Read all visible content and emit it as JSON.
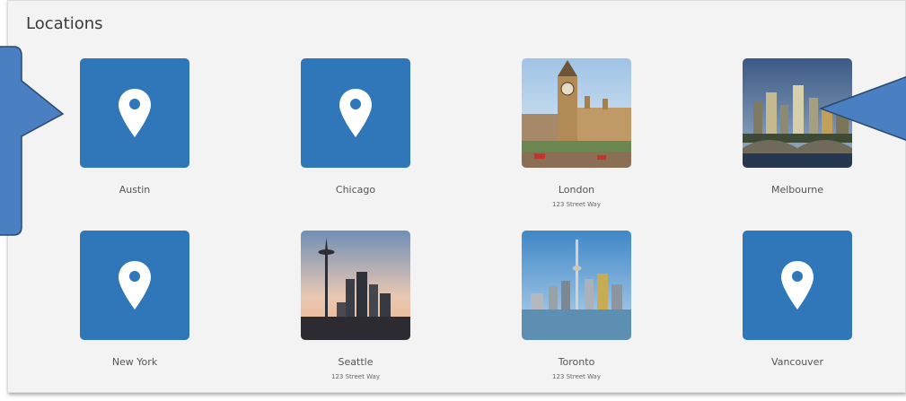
{
  "panel": {
    "title": "Locations"
  },
  "locations": [
    {
      "name": "Austin",
      "address": "",
      "thumb": "pin-icon"
    },
    {
      "name": "Chicago",
      "address": "",
      "thumb": "pin-icon"
    },
    {
      "name": "London",
      "address": "123 Street Way",
      "thumb": "london-photo"
    },
    {
      "name": "Melbourne",
      "address": "",
      "thumb": "melbourne-photo"
    },
    {
      "name": "New York",
      "address": "",
      "thumb": "pin-icon"
    },
    {
      "name": "Seattle",
      "address": "123 Street Way",
      "thumb": "seattle-photo"
    },
    {
      "name": "Toronto",
      "address": "123 Street Way",
      "thumb": "toronto-photo"
    },
    {
      "name": "Vancouver",
      "address": "",
      "thumb": "pin-icon"
    }
  ],
  "colors": {
    "pin_tile": "#2f77b9",
    "callout_fill": "#4a7fc1",
    "callout_stroke": "#2b4a72"
  }
}
